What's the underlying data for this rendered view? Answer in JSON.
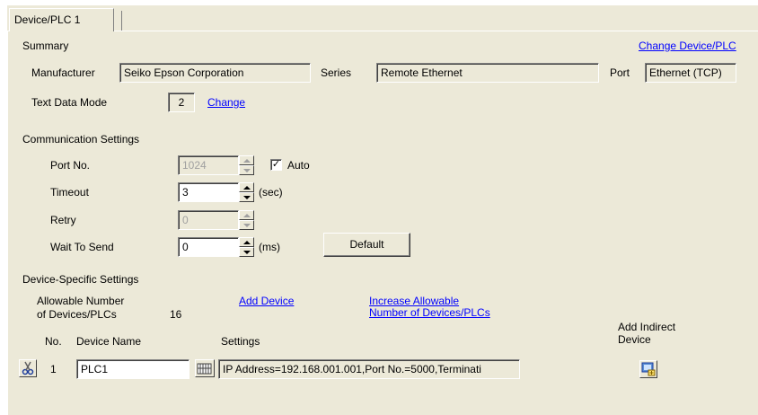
{
  "tab": {
    "label": "Device/PLC 1"
  },
  "summary": {
    "heading": "Summary",
    "change_device_link": "Change Device/PLC",
    "manufacturer_label": "Manufacturer",
    "manufacturer_value": "Seiko Epson Corporation",
    "series_label": "Series",
    "series_value": "Remote Ethernet",
    "port_label": "Port",
    "port_value": "Ethernet (TCP)",
    "text_mode_label": "Text Data Mode",
    "text_mode_value": "2",
    "text_mode_change_link": "Change"
  },
  "comm": {
    "heading": "Communication Settings",
    "port_no_label": "Port No.",
    "port_no_value": "1024",
    "auto_label": "Auto",
    "auto_checked": true,
    "timeout_label": "Timeout",
    "timeout_value": "3",
    "timeout_unit": "(sec)",
    "retry_label": "Retry",
    "retry_value": "0",
    "wait_label": "Wait To Send",
    "wait_value": "0",
    "wait_unit": "(ms)",
    "default_button": "Default"
  },
  "device": {
    "heading": "Device-Specific Settings",
    "allowable_label_1": "Allowable Number",
    "allowable_label_2": "of Devices/PLCs",
    "allowable_value": "16",
    "add_device_link": "Add Device",
    "increase_link_1": "Increase Allowable",
    "increase_link_2": "Number of Devices/PLCs",
    "col_no": "No.",
    "col_name": "Device Name",
    "col_settings": "Settings",
    "add_indirect_1": "Add Indirect",
    "add_indirect_2": "Device",
    "rows": [
      {
        "no": "1",
        "name": "PLC1",
        "settings": "IP Address=192.168.001.001,Port No.=5000,Terminati"
      }
    ]
  }
}
